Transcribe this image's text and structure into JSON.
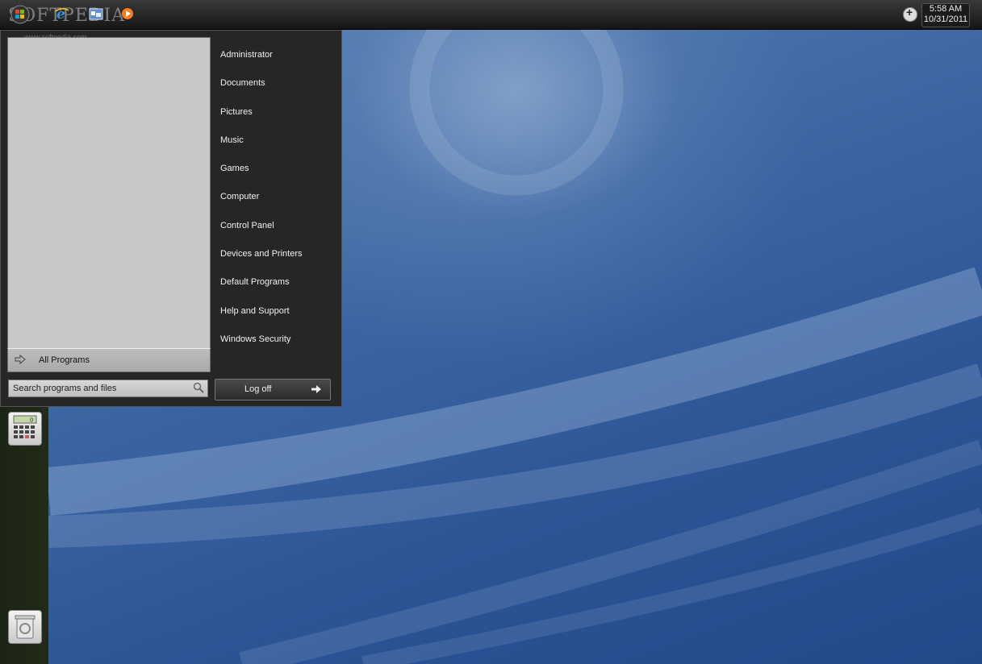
{
  "taskbar": {
    "watermark": "SOFTPEDIA",
    "watermark_small": "www.softpedia.com",
    "clock": {
      "time": "5:58 AM",
      "date": "10/31/2011"
    }
  },
  "start_menu": {
    "all_programs_label": "All Programs",
    "search_placeholder": "Search programs and files",
    "places": [
      "Administrator",
      "Documents",
      "Pictures",
      "Music",
      "Games",
      "Computer",
      "Control Panel",
      "Devices and Printers",
      "Default Programs",
      "Help and Support",
      "Windows Security"
    ],
    "logoff_label": "Log off"
  },
  "dock": {
    "calculator_display": "0"
  },
  "icons": {
    "start": "windows-orb-icon",
    "browser": "internet-explorer-icon",
    "explorer": "windows-explorer-icon",
    "media": "media-player-icon",
    "tray": "plus-circle-icon",
    "calculator": "calculator-icon",
    "recycle": "recycle-bin-icon"
  }
}
